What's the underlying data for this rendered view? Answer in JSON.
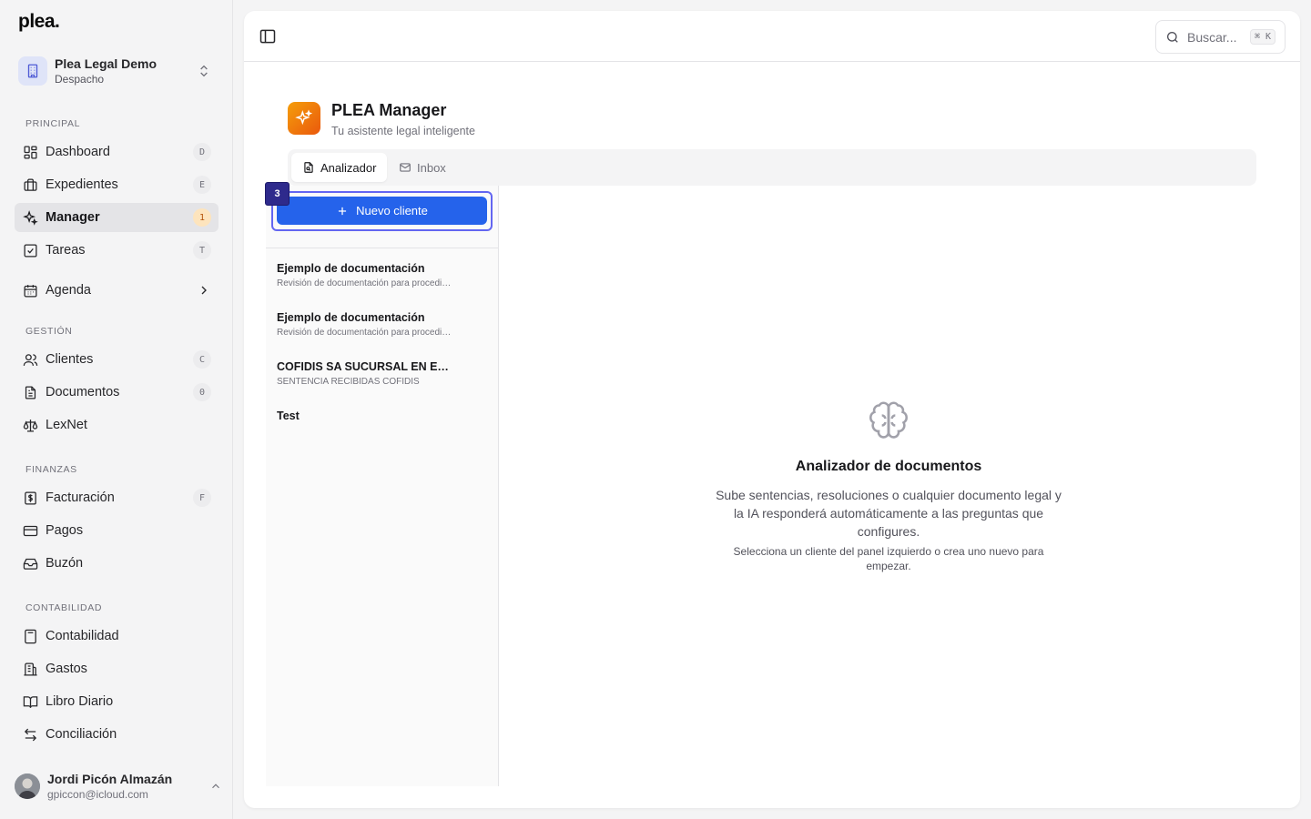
{
  "logo": "plea.",
  "org": {
    "name": "Plea Legal Demo",
    "type": "Despacho"
  },
  "sections": {
    "principal": "PRINCIPAL",
    "gestion": "GESTIÓN",
    "finanzas": "FINANZAS",
    "contabilidad": "CONTABILIDAD"
  },
  "nav": {
    "dashboard": {
      "label": "Dashboard",
      "badge": "D"
    },
    "expedientes": {
      "label": "Expedientes",
      "badge": "E"
    },
    "manager": {
      "label": "Manager",
      "badge": "1"
    },
    "tareas": {
      "label": "Tareas",
      "badge": "T"
    },
    "agenda": {
      "label": "Agenda"
    },
    "clientes": {
      "label": "Clientes",
      "badge": "C"
    },
    "documentos": {
      "label": "Documentos",
      "badge": "0"
    },
    "lexnet": {
      "label": "LexNet"
    },
    "facturacion": {
      "label": "Facturación",
      "badge": "F"
    },
    "pagos": {
      "label": "Pagos"
    },
    "buzon": {
      "label": "Buzón"
    },
    "contabilidad": {
      "label": "Contabilidad"
    },
    "gastos": {
      "label": "Gastos"
    },
    "libro_diario": {
      "label": "Libro Diario"
    },
    "conciliacion": {
      "label": "Conciliación"
    }
  },
  "user": {
    "name": "Jordi Picón Almazán",
    "email": "gpiccon@icloud.com"
  },
  "search": {
    "placeholder": "Buscar...",
    "shortcut": "⌘ K"
  },
  "app": {
    "title": "PLEA Manager",
    "subtitle": "Tu asistente legal inteligente"
  },
  "tabs": [
    {
      "label": "Analizador",
      "active": true
    },
    {
      "label": "Inbox",
      "active": false
    }
  ],
  "new_client": {
    "label": "Nuevo cliente",
    "step": "3"
  },
  "clients": [
    {
      "name": "Ejemplo de documentación",
      "desc": "Revisión de documentación para procedimiento"
    },
    {
      "name": "Ejemplo de documentación",
      "desc": "Revisión de documentación para procedimiento"
    },
    {
      "name": "COFIDIS SA SUCURSAL EN ESPAÑA",
      "desc": "SENTENCIA RECIBIDAS COFIDIS"
    },
    {
      "name": "Test",
      "desc": ""
    }
  ],
  "empty_state": {
    "title": "Analizador de documentos",
    "text": "Sube sentencias, resoluciones o cualquier documento legal y la IA responderá automáticamente a las preguntas que configures.",
    "hint": "Selecciona un cliente del panel izquierdo o crea uno nuevo para empezar."
  },
  "colors": {
    "accent": "#2563eb",
    "highlight": "#6366f1",
    "brand_orange": "#ea580c"
  }
}
